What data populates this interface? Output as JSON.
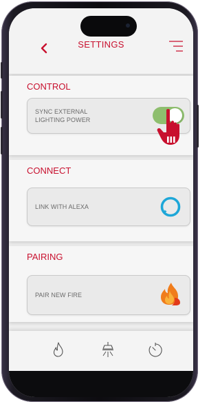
{
  "header": {
    "title": "SETTINGS",
    "back_icon": "chevron-left-icon",
    "menu_icon": "hamburger-menu-icon"
  },
  "sections": [
    {
      "title": "CONTROL",
      "card": {
        "label_line1": "SYNC EXTERNAL",
        "label_line2": "LIGHTING POWER",
        "control": "toggle",
        "toggle_on": true
      }
    },
    {
      "title": "CONNECT",
      "card": {
        "label": "LINK WITH ALEXA",
        "icon": "alexa-icon"
      }
    },
    {
      "title": "PAIRING",
      "card": {
        "label": "PAIR NEW FIRE",
        "icon": "flame-icon"
      }
    }
  ],
  "bottom_nav": {
    "items": [
      "flame-icon",
      "ceiling-light-icon",
      "timer-icon"
    ]
  },
  "colors": {
    "accent": "#c8102e",
    "toggle_on": "#8ebe6e",
    "alexa": "#1ea7d8",
    "flame_orange": "#f07d1c"
  }
}
